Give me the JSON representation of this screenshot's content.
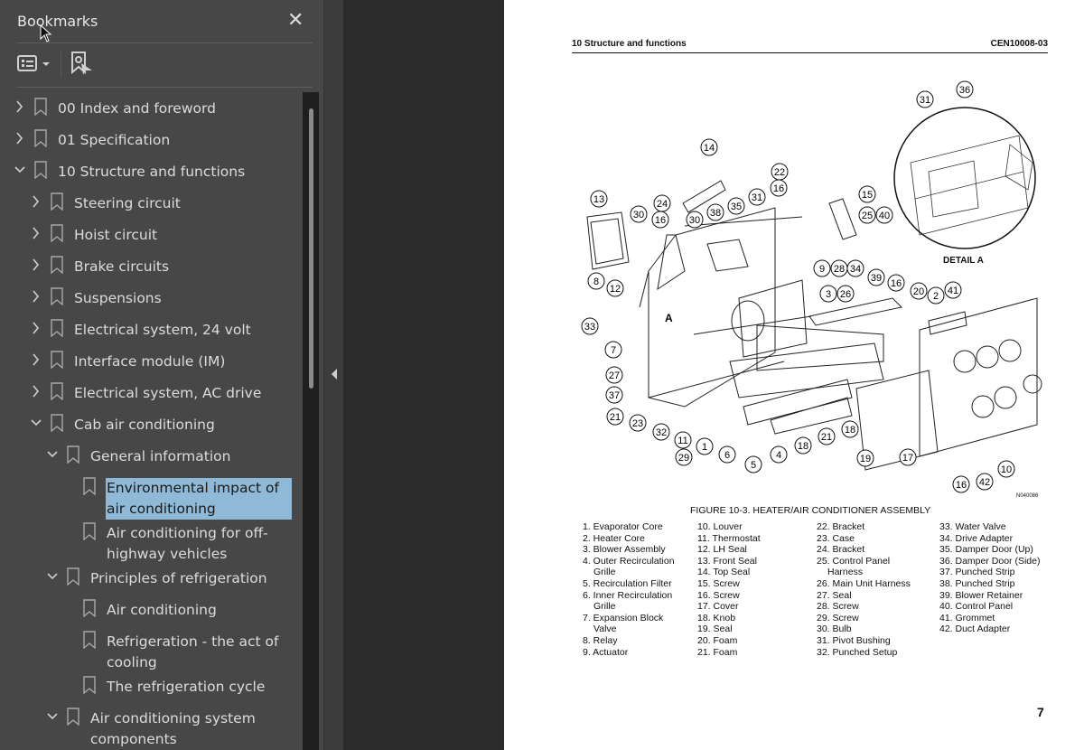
{
  "sidebar": {
    "title": "Bookmarks",
    "close_icon": "close-icon",
    "options_icon": "list-options-icon",
    "add_bookmark_icon": "add-bookmark-icon",
    "items": [
      {
        "label": "00 Index and foreword",
        "level": 0,
        "state": "collapsed"
      },
      {
        "label": "01 Specification",
        "level": 0,
        "state": "collapsed"
      },
      {
        "label": "10 Structure and functions",
        "level": 0,
        "state": "expanded"
      },
      {
        "label": "Steering circuit",
        "level": 1,
        "state": "collapsed"
      },
      {
        "label": "Hoist circuit",
        "level": 1,
        "state": "collapsed"
      },
      {
        "label": "Brake circuits",
        "level": 1,
        "state": "collapsed"
      },
      {
        "label": "Suspensions",
        "level": 1,
        "state": "collapsed"
      },
      {
        "label": "Electrical system, 24 volt",
        "level": 1,
        "state": "collapsed"
      },
      {
        "label": "Interface module (IM)",
        "level": 1,
        "state": "collapsed"
      },
      {
        "label": "Electrical system, AC drive",
        "level": 1,
        "state": "collapsed"
      },
      {
        "label": "Cab air conditioning",
        "level": 1,
        "state": "expanded"
      },
      {
        "label": "General information",
        "level": 2,
        "state": "expanded"
      },
      {
        "label": "Environmental impact of air conditioning",
        "level": 3,
        "state": "leaf",
        "selected": true
      },
      {
        "label": "Air conditioning for off-highway vehicles",
        "level": 3,
        "state": "leaf"
      },
      {
        "label": "Principles of refrigeration",
        "level": 2,
        "state": "expanded"
      },
      {
        "label": "Air conditioning",
        "level": 3,
        "state": "leaf"
      },
      {
        "label": "Refrigeration - the act of cooling",
        "level": 3,
        "state": "leaf"
      },
      {
        "label": "The refrigeration cycle",
        "level": 3,
        "state": "leaf"
      },
      {
        "label": "Air conditioning system components",
        "level": 2,
        "state": "expanded"
      }
    ]
  },
  "page": {
    "header_left": "10 Structure and functions",
    "header_right": "CEN10008-03",
    "figure_caption": "FIGURE 10-3. HEATER/AIR CONDITIONER ASSEMBLY",
    "figure_id": "N040086",
    "detail_label": "DETAIL A",
    "section_marker": "A",
    "page_number": "7",
    "callouts": [
      "14",
      "13",
      "30",
      "24",
      "16",
      "30",
      "38",
      "35",
      "22",
      "31",
      "16",
      "15",
      "25",
      "40",
      "8",
      "12",
      "9",
      "28",
      "34",
      "39",
      "3",
      "26",
      "16",
      "20",
      "2",
      "41",
      "33",
      "7",
      "27",
      "37",
      "21",
      "23",
      "32",
      "11",
      "29",
      "1",
      "6",
      "5",
      "4",
      "18",
      "21",
      "18",
      "19",
      "17",
      "16",
      "42",
      "10",
      "31",
      "36"
    ],
    "legend": [
      [
        "1. Evaporator Core",
        "2. Heater Core",
        "3. Blower Assembly",
        "4. Outer Recirculation Grille",
        "5. Recirculation Filter",
        "6. Inner Recirculation Grille",
        "7. Expansion Block Valve",
        "8. Relay",
        "9. Actuator"
      ],
      [
        "10. Louver",
        "11. Thermostat",
        "12. LH Seal",
        "13. Front Seal",
        "14. Top Seal",
        "15. Screw",
        "16. Screw",
        "17. Cover",
        "18. Knob",
        "19. Seal",
        "20. Foam",
        "21. Foam"
      ],
      [
        "22. Bracket",
        "23. Case",
        "24. Bracket",
        "25. Control Panel Harness",
        "26. Main Unit Harness",
        "27. Seal",
        "28. Screw",
        "29. Screw",
        "30. Bulb",
        "31. Pivot Bushing",
        "32. Punched Setup"
      ],
      [
        "33. Water Valve",
        "34. Drive Adapter",
        "35. Damper Door (Up)",
        "36. Damper Door (Side)",
        "37. Punched Strip",
        "38. Punched Strip",
        "39. Blower Retainer",
        "40. Control Panel",
        "41. Grommet",
        "42. Duct Adapter"
      ]
    ]
  },
  "colors": {
    "sidebar_bg": "#474747",
    "selection": "#8fb9d6",
    "viewer_bg": "#2b2b2b"
  }
}
